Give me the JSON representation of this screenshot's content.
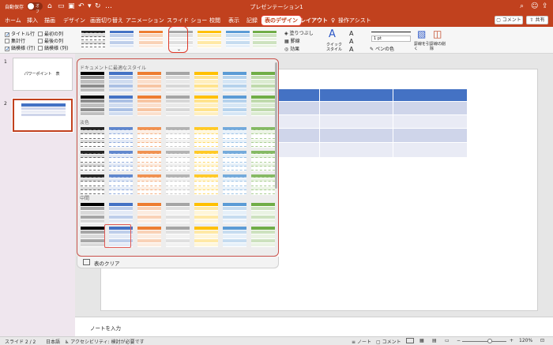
{
  "titlebar": {
    "autosave": "自動保存",
    "toggle": "オフ",
    "title": "プレゼンテーション1"
  },
  "tabs": [
    "ホーム",
    "挿入",
    "描画",
    "デザイン",
    "画面切り替え",
    "アニメーション",
    "スライド ショー",
    "校閲",
    "表示",
    "記録",
    "表のデザイン",
    "レイアウト",
    "操作アシスト"
  ],
  "header_buttons": {
    "comment": "コメント",
    "share": "共有"
  },
  "ribbon": {
    "options": [
      {
        "label": "タイトル行",
        "checked": true
      },
      {
        "label": "最初の列",
        "checked": false
      },
      {
        "label": "集計行",
        "checked": false
      },
      {
        "label": "最後の列",
        "checked": false
      },
      {
        "label": "縞模様 (行)",
        "checked": true
      },
      {
        "label": "縞模様 (列)",
        "checked": false
      }
    ],
    "shading": "塗りつぶし",
    "border": "罫線",
    "effects": "効果",
    "quick_style": "クイック スタイル",
    "line_weight": "1 pt",
    "pen_color": "ペンの色",
    "draw_table": "罫線を引く",
    "eraser": "罫線の削除"
  },
  "slides": [
    {
      "number": "1",
      "text": "パワーポイント　表"
    },
    {
      "number": "2",
      "text": ""
    }
  ],
  "gallery": {
    "section_best": "ドキュメントに最適なスタイル",
    "section_light": "淡色",
    "section_medium": "中間",
    "clear": "表のクリア"
  },
  "notes": "ノートを入力",
  "status": {
    "slide": "スライド 2 / 2",
    "language": "日本語",
    "accessibility": "アクセシビリティ: 検討が必要です",
    "notes": "ノート",
    "comments": "コメント",
    "zoom": "120%"
  },
  "colors": {
    "accent": "#c1411e",
    "palette": [
      "#000000",
      "#4472c4",
      "#ed7d31",
      "#a5a5a5",
      "#ffc000",
      "#5b9bd5",
      "#70ad47"
    ]
  }
}
